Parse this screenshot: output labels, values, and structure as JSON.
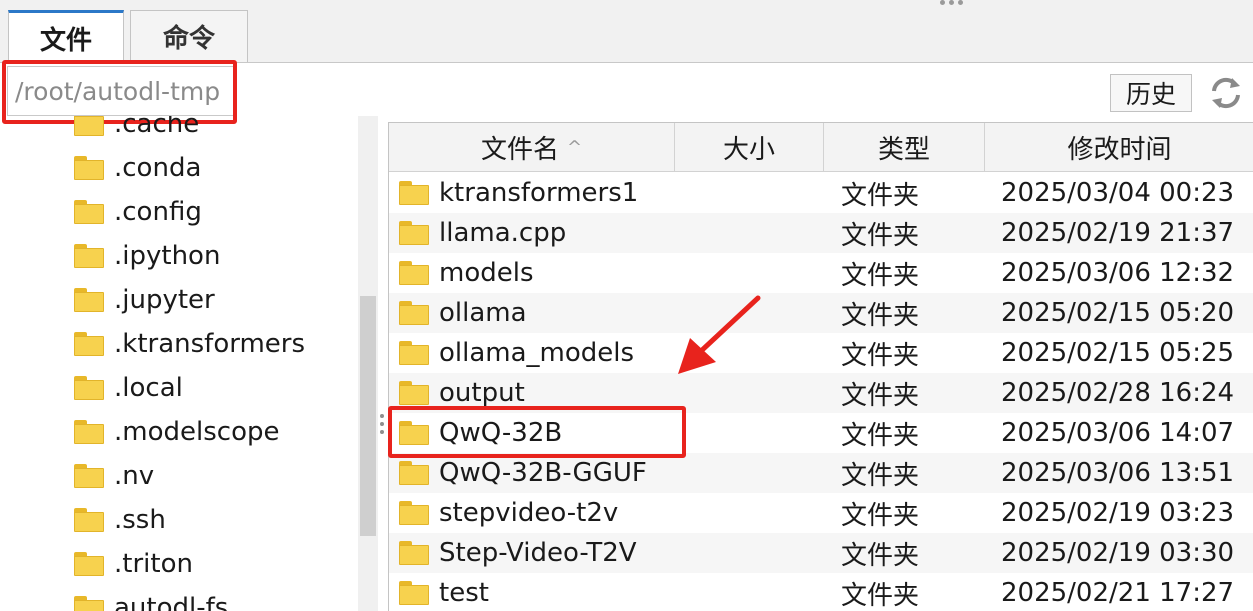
{
  "tabs": [
    {
      "label": "文件",
      "active": true
    },
    {
      "label": "命令",
      "active": false
    }
  ],
  "path": {
    "value": "/root/autodl-tmp"
  },
  "toolbar": {
    "history_label": "历史",
    "refresh_icon": "refresh-icon"
  },
  "tree": {
    "items": [
      {
        "label": ".cache"
      },
      {
        "label": ".conda"
      },
      {
        "label": ".config"
      },
      {
        "label": ".ipython"
      },
      {
        "label": ".jupyter"
      },
      {
        "label": ".ktransformers"
      },
      {
        "label": ".local"
      },
      {
        "label": ".modelscope"
      },
      {
        "label": ".nv"
      },
      {
        "label": ".ssh"
      },
      {
        "label": ".triton"
      },
      {
        "label": "autodl-fs"
      }
    ]
  },
  "table": {
    "columns": {
      "name": "文件名",
      "size": "大小",
      "type": "类型",
      "modified": "修改时间"
    },
    "sort_indicator": "^",
    "rows": [
      {
        "name": "ktransformers1",
        "size": "",
        "type": "文件夹",
        "modified": "2025/03/04 00:23"
      },
      {
        "name": "llama.cpp",
        "size": "",
        "type": "文件夹",
        "modified": "2025/02/19 21:37"
      },
      {
        "name": "models",
        "size": "",
        "type": "文件夹",
        "modified": "2025/03/06 12:32"
      },
      {
        "name": "ollama",
        "size": "",
        "type": "文件夹",
        "modified": "2025/02/15 05:20"
      },
      {
        "name": "ollama_models",
        "size": "",
        "type": "文件夹",
        "modified": "2025/02/15 05:25"
      },
      {
        "name": "output",
        "size": "",
        "type": "文件夹",
        "modified": "2025/02/28 16:24"
      },
      {
        "name": "QwQ-32B",
        "size": "",
        "type": "文件夹",
        "modified": "2025/03/06 14:07"
      },
      {
        "name": "QwQ-32B-GGUF",
        "size": "",
        "type": "文件夹",
        "modified": "2025/03/06 13:51"
      },
      {
        "name": "stepvideo-t2v",
        "size": "",
        "type": "文件夹",
        "modified": "2025/02/19 03:23"
      },
      {
        "name": "Step-Video-T2V",
        "size": "",
        "type": "文件夹",
        "modified": "2025/02/19 03:30"
      },
      {
        "name": "test",
        "size": "",
        "type": "文件夹",
        "modified": "2025/02/21 17:27"
      }
    ]
  },
  "colors": {
    "accent": "#2b78c8",
    "annotation": "#e8231d",
    "folder": "#f7d24e"
  }
}
